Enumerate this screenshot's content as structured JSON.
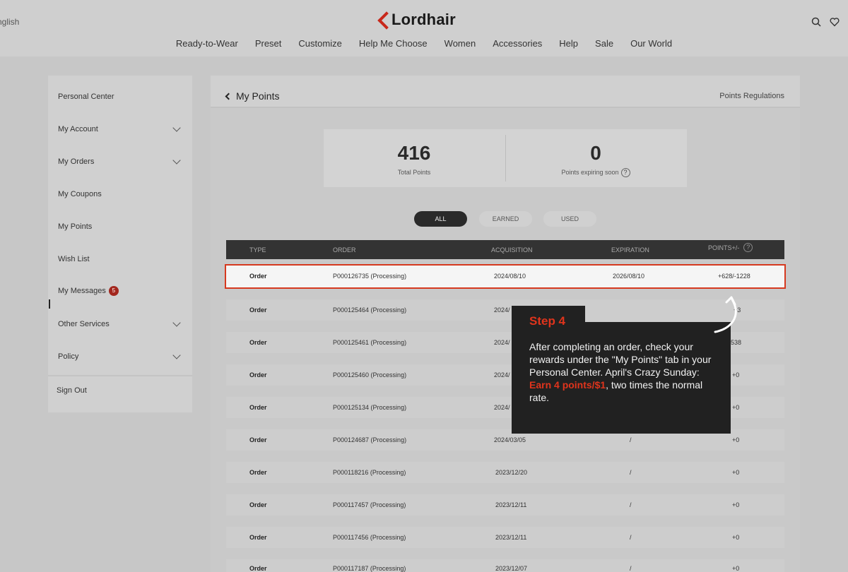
{
  "header": {
    "language": "nglish",
    "logo_text": "Lordhair",
    "nav": [
      "Ready-to-Wear",
      "Preset",
      "Customize",
      "Help Me Choose",
      "Women",
      "Accessories",
      "Help",
      "Sale",
      "Our World"
    ]
  },
  "sidebar": {
    "items": [
      {
        "label": "Personal Center"
      },
      {
        "label": "My Account"
      },
      {
        "label": "My Orders"
      },
      {
        "label": "My Coupons"
      },
      {
        "label": "My Points"
      },
      {
        "label": "Wish List"
      },
      {
        "label": "My Messages",
        "badge": "5"
      },
      {
        "label": "Other Services"
      },
      {
        "label": "Policy"
      },
      {
        "label": "Sign Out"
      }
    ]
  },
  "main": {
    "title": "My Points",
    "regulations_link": "Points Regulations",
    "summary": {
      "total_points": "416",
      "total_points_label": "Total Points",
      "expiring_points": "0",
      "expiring_label": "Points expiring soon",
      "help": "?"
    },
    "tabs": [
      "ALL",
      "EARNED",
      "USED"
    ],
    "table": {
      "headers": [
        "TYPE",
        "ORDER",
        "ACQUISITION",
        "EXPIRATION",
        "POINTS+/-"
      ],
      "help": "?",
      "rows": [
        {
          "type": "Order",
          "order": "P000126735 (Processing)",
          "acq": "2024/08/10",
          "exp": "2026/08/10",
          "pts": "+628/-1228"
        },
        {
          "type": "Order",
          "order": "P000125464 (Processing)",
          "acq": "2024/",
          "exp": "/",
          "pts": "+3"
        },
        {
          "type": "Order",
          "order": "P000125461 (Processing)",
          "acq": "2024/",
          "exp": "",
          "pts": "538"
        },
        {
          "type": "Order",
          "order": "P000125460 (Processing)",
          "acq": "2024/",
          "exp": "",
          "pts": "+0"
        },
        {
          "type": "Order",
          "order": "P000125134 (Processing)",
          "acq": "2024/",
          "exp": "",
          "pts": "+0"
        },
        {
          "type": "Order",
          "order": "P000124687 (Processing)",
          "acq": "2024/03/05",
          "exp": "/",
          "pts": "+0"
        },
        {
          "type": "Order",
          "order": "P000118216 (Processing)",
          "acq": "2023/12/20",
          "exp": "/",
          "pts": "+0"
        },
        {
          "type": "Order",
          "order": "P000117457 (Processing)",
          "acq": "2023/12/11",
          "exp": "/",
          "pts": "+0"
        },
        {
          "type": "Order",
          "order": "P000117456 (Processing)",
          "acq": "2023/12/11",
          "exp": "/",
          "pts": "+0"
        },
        {
          "type": "Order",
          "order": "P000117187 (Processing)",
          "acq": "2023/12/07",
          "exp": "/",
          "pts": "+0"
        }
      ]
    }
  },
  "tooltip": {
    "title": "Step 4",
    "text_before": "After completing an order, check your rewards under the \"My Points\" tab in your Personal Center. April's Crazy Sunday: ",
    "highlight": "Earn 4 points/$1",
    "text_after": ", two times the normal rate."
  },
  "colors": {
    "accent": "#e0341c",
    "highlight_border": "#d6391f",
    "tooltip_bg": "#212121"
  }
}
